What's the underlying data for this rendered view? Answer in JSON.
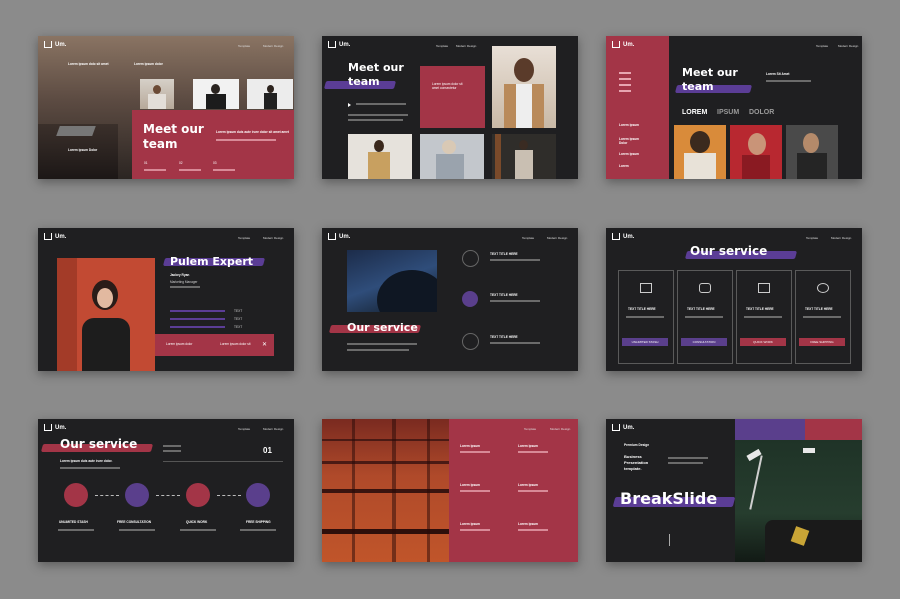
{
  "colors": {
    "background": "#8b8b8b",
    "slide": "#1f1f21",
    "crimson": "#a33547",
    "purple": "#5a3f8c"
  },
  "brand": "Um.",
  "nav": {
    "item1": "Template",
    "item2": "Modern Design"
  },
  "slide1": {
    "heading": "Meet our team",
    "tagline1": "Lorem ipsum dolo sit amet",
    "tagline2": "Lorem ipsum dolor",
    "sub": "Lorem ipsum duis aute irure dolor sit amet amet",
    "name": "Lorem ipsum Dolor",
    "num1": "01",
    "num2": "02",
    "num3": "03"
  },
  "slide2": {
    "heading": "Meet our team",
    "box_text": "Lorem ipsum dolor sit amet consectetur"
  },
  "slide3": {
    "heading": "Meet our team",
    "sub": "Lorem Sit Amet",
    "tab1": "LOREM",
    "tab2": "IPSUM",
    "tab3": "DOLOR",
    "side": [
      "Lorem ipsum",
      "Lorem ipsum Dolor",
      "Lorem ipsum",
      "Lorem"
    ]
  },
  "slide4": {
    "heading": "Pulem Expert",
    "name": "Jackey Ryan",
    "role": "Marketing Manager",
    "bars": [
      "TEXT",
      "TEXT",
      "TEXT"
    ],
    "footer1": "Lorem ipsum dolor",
    "footer2": "Lorem ipsum dolor sit",
    "close": "✕"
  },
  "slide5": {
    "heading": "Our service",
    "items": [
      "TEXT TITLE HERE",
      "TEXT TITLE HERE",
      "TEXT TITLE HERE"
    ]
  },
  "slide6": {
    "heading": "Our service",
    "cards": [
      {
        "title": "TEXT TITLE HERE",
        "btn": "UNLIMITED STASH"
      },
      {
        "title": "TEXT TITLE HERE",
        "btn": "CONSULTATION"
      },
      {
        "title": "TEXT TITLE HERE",
        "btn": "QUICK WORK"
      },
      {
        "title": "TEXT TITLE HERE",
        "btn": "FREE SHIPPING"
      }
    ]
  },
  "slide7": {
    "heading": "Our service",
    "number": "01",
    "sub": "Lorem ipsum duis aute irure dolor.",
    "steps": [
      "UNLIMITED STASH",
      "FREE CONSULTATION",
      "QUICK WORK",
      "FREE SHIPPING"
    ]
  },
  "slide8": {
    "items": [
      "Lorem ipsum",
      "Lorem ipsum",
      "Lorem ipsum",
      "Lorem ipsum",
      "Lorem ipsum",
      "Lorem ipsum"
    ]
  },
  "slide9": {
    "pre": "Premium Design",
    "line1": "Business",
    "line2": "Presentation",
    "line3": "template.",
    "heading": "BreakSlide"
  }
}
